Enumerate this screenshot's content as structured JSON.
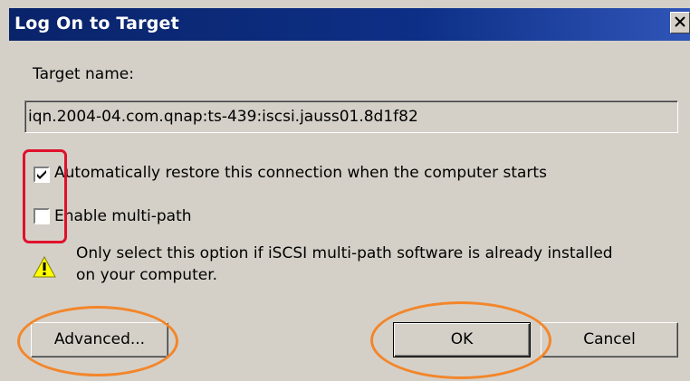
{
  "window": {
    "title": "Log On to Target",
    "close_icon": "close-icon"
  },
  "target": {
    "label": "Target name:",
    "value": "iqn.2004-04.com.qnap:ts-439:iscsi.jauss01.8d1f82"
  },
  "options": {
    "auto_restore": {
      "label": "Automatically restore this connection when the computer starts",
      "checked": true
    },
    "multi_path": {
      "label": "Enable multi-path",
      "checked": false
    }
  },
  "warning": {
    "icon": "warning-icon",
    "line1": "Only select this option if iSCSI multi-path software is already installed",
    "line2": "on your computer."
  },
  "buttons": {
    "advanced": "Advanced...",
    "ok": "OK",
    "cancel": "Cancel"
  },
  "colors": {
    "titlebar": "#0a246a",
    "dialog_bg": "#d4d0c8",
    "red_highlight": "#e0112b",
    "orange_highlight": "#f3862a"
  }
}
